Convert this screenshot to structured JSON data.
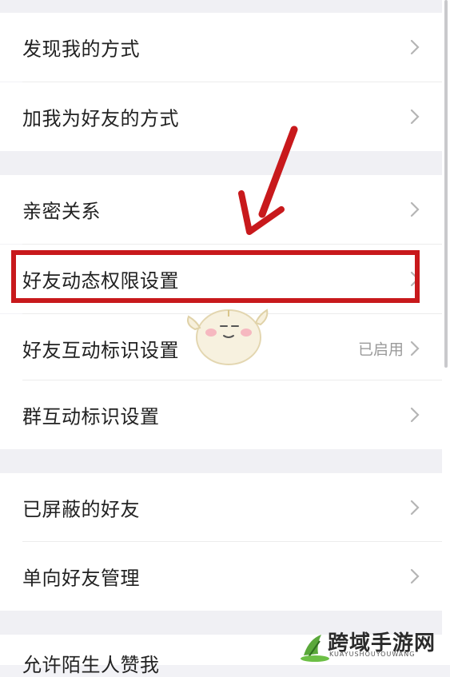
{
  "settings": {
    "items": [
      {
        "label": "发现我的方式"
      },
      {
        "label": "加我为好友的方式"
      },
      {
        "label": "亲密关系"
      },
      {
        "label": "好友动态权限设置"
      },
      {
        "label": "好友互动标识设置",
        "status": "已启用"
      },
      {
        "label": "群互动标识设置"
      },
      {
        "label": "已屏蔽的好友"
      },
      {
        "label": "单向好友管理"
      },
      {
        "label": "允许陌生人赞我"
      }
    ]
  },
  "annotation": {
    "arrow_color": "#c8191c",
    "highlight_color": "#c8191c"
  },
  "watermark": {
    "title": "跨域手游网",
    "subtitle": "KUAYUSHOUYOUWANG"
  },
  "icons": {
    "chevron": "chevron-right-icon"
  }
}
